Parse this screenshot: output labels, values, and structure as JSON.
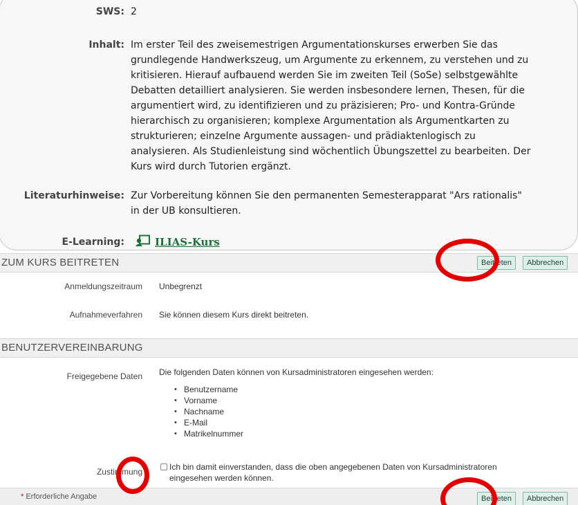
{
  "course": {
    "sws_label": "SWS:",
    "sws_value": "2",
    "inhalt_label": "Inhalt:",
    "inhalt_lines": [
      "Im erster Teil des zweisemestrigen Argumentationskurses erwerben Sie das",
      "grundlegende Handwerkszeug, um Argumente zu erkennem, zu verstehen und zu",
      "kritisieren. Hierauf aufbauend werden Sie im zweiten Teil (SoSe) selbstgewählte",
      "Debatten detailliert analysieren. Sie werden insbesondere lernen, Thesen, für die",
      "argumentiert wird, zu identifizieren und zu präzisieren; Pro- und Kontra-Gründe",
      "hierarchisch zu organisieren; komplexe Argumentation als Argumentkarten zu",
      "strukturieren; einzelne Argumente aussagen- und prädiaktenlogisch zu",
      "analysieren. Als Studienleistung sind wöchentlich Übungszettel zu bearbeiten. Der",
      "Kurs wird durch Tutorien ergänzt."
    ],
    "literatur_label": "Literaturhinweise:",
    "literatur_lines": [
      "Zur Vorbereitung können Sie den permanenten Semesterapparat \"Ars rationalis\"",
      "in der UB konsultieren."
    ],
    "elearning_label": "E-Learning:",
    "elearning_icon": "ilias-course-icon",
    "elearning_link": "ILIAS-Kurs"
  },
  "join": {
    "title": "ZUM KURS BEITRETEN",
    "btn_join": "Beitreten",
    "btn_cancel": "Abbrechen",
    "period_label": "Anmeldungszeitraum",
    "period_value": "Unbegrenzt",
    "procedure_label": "Aufnahmeverfahren",
    "procedure_value": "Sie können diesem Kurs direkt beitreten."
  },
  "agreement": {
    "title": "BENUTZERVEREINBARUNG",
    "data_label": "Freigegebene Daten",
    "data_intro": "Die folgenden Daten können von Kursadministratoren eingesehen werden:",
    "data_items": [
      "Benutzername",
      "Vorname",
      "Nachname",
      "E-Mail",
      "Matrikelnummer"
    ],
    "consent_label": "Zustimmung",
    "consent_line1": "Ich bin damit einverstanden, dass die oben angegebenen Daten von Kursadministratoren",
    "consent_line2": "eingesehen werden können.",
    "consent_checked": false
  },
  "footer": {
    "required_star": "*",
    "required_text": "Erforderliche Angabe",
    "btn_join": "Beitreten",
    "btn_cancel": "Abbrechen"
  },
  "colors": {
    "annotation": "#e00000",
    "button_bg": "#dff0ea",
    "link": "#1f6f3b"
  }
}
